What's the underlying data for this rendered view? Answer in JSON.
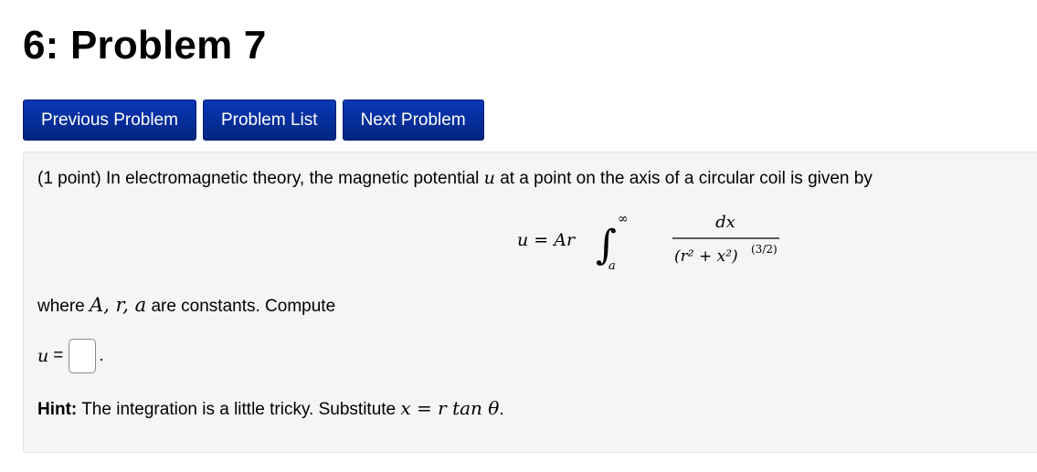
{
  "header": {
    "title": "6: Problem 7"
  },
  "nav": {
    "previous_label": "Previous Problem",
    "list_label": "Problem List",
    "next_label": "Next Problem"
  },
  "problem": {
    "points": "(1 point)",
    "intro_text": "In electromagnetic theory, the magnetic potential",
    "var_u": "u",
    "intro_text_end": "at a point on the axis of a circular coil is given by",
    "equation": {
      "lhs": "u = Ar",
      "integral_upper": "∞",
      "integral_lower": "a",
      "numerator": "dx",
      "denominator": "(r² + x²)",
      "exponent": "(3/2)"
    },
    "where_text": "where",
    "constants": "A, r, a",
    "where_end": "are constants. Compute",
    "answer_label": "u",
    "answer_equals": "=",
    "answer_value": "",
    "answer_period": ".",
    "hint_label": "Hint:",
    "hint_text": "The integration is a little tricky. Substitute",
    "hint_math": "x = r tan θ",
    "hint_period": "."
  }
}
